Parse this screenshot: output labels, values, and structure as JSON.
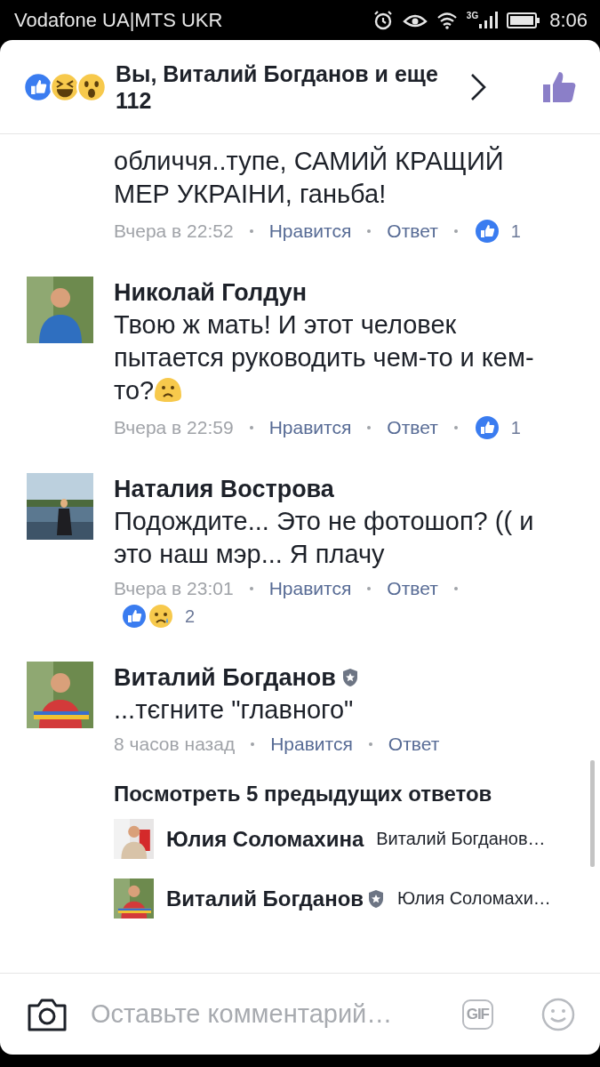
{
  "status_bar": {
    "carrier": "Vodafone UA|MTS UKR",
    "network": "3G",
    "time": "8:06"
  },
  "header": {
    "reactions": [
      {
        "kind": "like"
      },
      {
        "kind": "haha"
      },
      {
        "kind": "wow"
      }
    ],
    "summary": "Вы, Виталий Богданов и еще 112"
  },
  "comments": [
    {
      "text": "обличчя..тупе, САМИЙ КРАЩИЙ МЕР УКРАІНИ, ганьба!",
      "time": "Вчера в 22:52",
      "like": "Нравится",
      "reply": "Ответ",
      "reactions": [
        {
          "kind": "like"
        }
      ],
      "count": "1"
    },
    {
      "avatar": {
        "kind": "picture"
      },
      "name": "Николай Голдун",
      "text": "Твою ж мать! И этот человек пытается руководить чем-то и кем-то?",
      "emoji_after": true,
      "time": "Вчера в 22:59",
      "like": "Нравится",
      "reply": "Ответ",
      "reactions": [
        {
          "kind": "like"
        }
      ],
      "count": "1"
    },
    {
      "avatar": {
        "kind": "picture"
      },
      "name": "Наталия Вострова",
      "text": "Подождите... Это не фотошоп? (( и это наш мэр... Я плачу",
      "time": "Вчера в 23:01",
      "like": "Нравится",
      "reply": "Ответ",
      "reactions": [
        {
          "kind": "like"
        },
        {
          "kind": "sad"
        }
      ],
      "count": "2",
      "reactions_wrap": true
    },
    {
      "avatar": {
        "kind": "picture"
      },
      "name": "Виталий Богданов",
      "verified": true,
      "text": "...тєгните \"главного\"",
      "time": "8 часов назад",
      "like": "Нравится",
      "reply": "Ответ"
    }
  ],
  "replies": {
    "more": "Посмотреть 5 предыдущих ответов",
    "items": [
      {
        "avatar": {
          "kind": "picture"
        },
        "name": "Юлия Соломахина",
        "text": "Виталий Богданов…"
      },
      {
        "avatar": {
          "kind": "picture"
        },
        "name": "Виталий Богданов",
        "verified": true,
        "text": "Юлия Соломахи…"
      }
    ]
  },
  "composer": {
    "placeholder": "Оставьте комментарий…",
    "gif": "GIF"
  }
}
